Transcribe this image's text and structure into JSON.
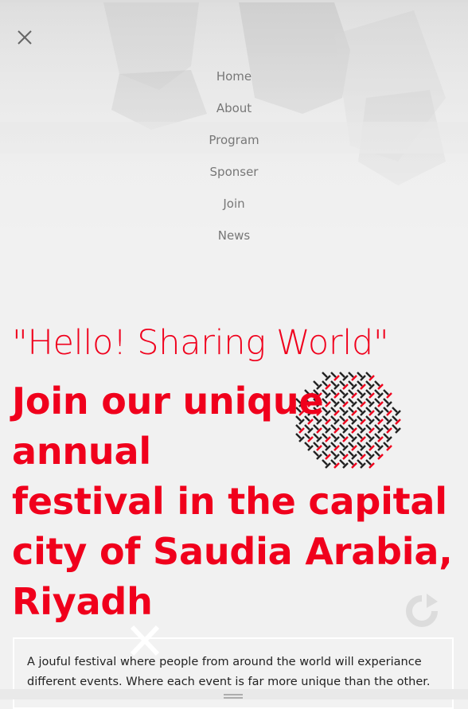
{
  "nav": {
    "close_icon": "close-icon",
    "items": [
      "Home",
      "About",
      "Program",
      "Sponser",
      "Join",
      "News"
    ]
  },
  "hero": {
    "greeting": "\"Hello! Sharing World\"",
    "headline_lines": [
      "Join our unique",
      "annual",
      "festival in the capital",
      "city of Saudia Arabia,",
      "Riyadh"
    ],
    "description": "A jouful festival where people from around the world will experiance different events. Where each event is far more unique than the other."
  },
  "colors": {
    "accent": "#f0001c",
    "nav_text": "#777777",
    "pattern_dark": "#222222"
  },
  "icons": [
    "close-icon",
    "pattern-decoration",
    "reload-icon",
    "close-x-icon",
    "menu-handle-icon"
  ]
}
